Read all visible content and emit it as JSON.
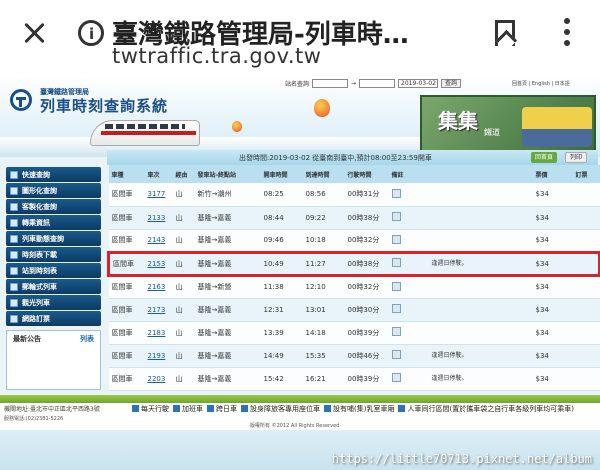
{
  "browser": {
    "title": "臺灣鐵路管理局-列車時…",
    "url": "twtraffic.tra.gov.tw",
    "info_icon_glyph": "i"
  },
  "header": {
    "org": "臺灣鐵路管理局",
    "site_title": "列車時刻查詢系統",
    "search_label": "站名查詢",
    "to_glyph": "→",
    "date_value": "2019-03-02",
    "search_button": "查詢",
    "langs": "回首頁 | English | 日本語",
    "promo_title": "集集",
    "promo_sub": "鐵道"
  },
  "query": {
    "title": "出發時間:2019-03-02 從臺南到臺中,預計08:00至23:59開車",
    "back": "回首頁",
    "print": "列印"
  },
  "sidebar": {
    "items": [
      {
        "label": "快速查詢",
        "icon": "search-icon"
      },
      {
        "label": "圖形化查詢",
        "icon": "chart-icon"
      },
      {
        "label": "客製化查詢",
        "icon": "settings-icon"
      },
      {
        "label": "轉乘資訊",
        "icon": "transfer-icon"
      },
      {
        "label": "列車動態查詢",
        "icon": "train-icon"
      },
      {
        "label": "時刻表下載",
        "icon": "download-icon"
      },
      {
        "label": "站到時刻表",
        "icon": "clock-icon"
      },
      {
        "label": "郵輪式列車",
        "icon": "ship-icon"
      },
      {
        "label": "觀光列車",
        "icon": "camera-icon"
      },
      {
        "label": "網路訂票",
        "icon": "ticket-icon"
      }
    ],
    "news_title": "最新公告",
    "news_more": "列表"
  },
  "table": {
    "headers": [
      "車種",
      "車次",
      "經由",
      "發車站-終點站",
      "開車時間",
      "到達時間",
      "行駛時間",
      "備註",
      "",
      "",
      "",
      "",
      "票價",
      "訂票"
    ],
    "rows": [
      {
        "type": "區間車",
        "no": "3177",
        "via": "山",
        "route": "新竹→潮州",
        "dep": "08:25",
        "arr": "08:56",
        "dur": "00時31分",
        "note": "",
        "price": "$34",
        "highlight": false
      },
      {
        "type": "區間車",
        "no": "2133",
        "via": "山",
        "route": "基隆→嘉義",
        "dep": "08:44",
        "arr": "09:22",
        "dur": "00時38分",
        "note": "",
        "price": "$34",
        "highlight": false
      },
      {
        "type": "區間車",
        "no": "2143",
        "via": "山",
        "route": "基隆→嘉義",
        "dep": "09:46",
        "arr": "10:18",
        "dur": "00時32分",
        "note": "",
        "price": "$34",
        "highlight": false
      },
      {
        "type": "區間車",
        "no": "2153",
        "via": "山",
        "route": "基隆→嘉義",
        "dep": "10:49",
        "arr": "11:27",
        "dur": "00時38分",
        "note": "逢週日停駛。",
        "price": "$34",
        "highlight": true
      },
      {
        "type": "區間車",
        "no": "2163",
        "via": "山",
        "route": "基隆→新營",
        "dep": "11:38",
        "arr": "12:10",
        "dur": "00時32分",
        "note": "",
        "price": "$34",
        "highlight": false
      },
      {
        "type": "區間車",
        "no": "2173",
        "via": "山",
        "route": "基隆→嘉義",
        "dep": "12:31",
        "arr": "13:01",
        "dur": "00時30分",
        "note": "",
        "price": "$34",
        "highlight": false
      },
      {
        "type": "區間車",
        "no": "2183",
        "via": "山",
        "route": "基隆→嘉義",
        "dep": "13:39",
        "arr": "14:18",
        "dur": "00時39分",
        "note": "",
        "price": "$34",
        "highlight": false
      },
      {
        "type": "區間車",
        "no": "2193",
        "via": "山",
        "route": "基隆→嘉義",
        "dep": "14:49",
        "arr": "15:35",
        "dur": "00時46分",
        "note": "逢週日停駛。",
        "price": "$34",
        "highlight": false
      },
      {
        "type": "區間車",
        "no": "2203",
        "via": "山",
        "route": "基隆→嘉義",
        "dep": "15:42",
        "arr": "16:21",
        "dur": "00時39分",
        "note": "逢週日停駛。",
        "price": "$34",
        "highlight": false
      }
    ]
  },
  "footer": {
    "left": "機關地址:臺北市中正區北平西路3號",
    "links": [
      "每天行駛",
      "加班車",
      "跨日車",
      "設身障旅客專用座位車",
      "設有哺(集)乳室車廂",
      "人車同行區間(置於攜車袋之自行車各級列車均可乘車)"
    ],
    "row2": "服務電話:(02)2381-5226",
    "row3": "版權所有 ©2012 All Rights Reserved"
  },
  "watermark": "https://little70713.pixnet.net/album"
}
